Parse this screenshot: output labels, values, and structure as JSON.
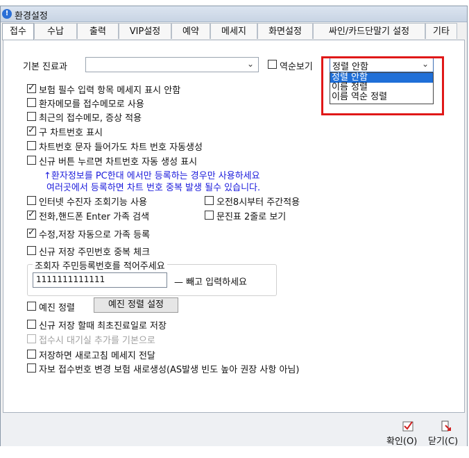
{
  "window": {
    "title": "환경설정"
  },
  "tabs": [
    "접수",
    "수납",
    "출력",
    "VIP설정",
    "예약",
    "메세지",
    "화면설정",
    "싸인/카드단말기 설정",
    "기타"
  ],
  "top_row": {
    "dept_label": "기본 진료과",
    "dept_value": "",
    "reverse_label": "역순보기",
    "sort_selected": "정렬 안함",
    "sort_options": [
      "정렬 안함",
      "이름 정렬",
      "이름 역순 정렬"
    ]
  },
  "options": [
    {
      "label": "보험 필수 입력 항목 메세지 표시 안함",
      "checked": true
    },
    {
      "label": "환자메모를 접수메모로 사용",
      "checked": false
    },
    {
      "label": "최근의 접수메모, 증상 적용",
      "checked": false
    },
    {
      "label": "구 차트번호 표시",
      "checked": true
    },
    {
      "label": "차트번호 문자 들어가도 차트 번호 자동생성",
      "checked": false
    },
    {
      "label": "신규 버튼 누르면 차트번호 자동 생성 표시",
      "checked": false
    }
  ],
  "notice": {
    "line1": "↑환자정보를 PC한대 에서만 등록하는 경우만 사용하세요",
    "line2": "여러곳에서 등록하면 차트 번호 중복 발생 될수 있습니다."
  },
  "options2": {
    "internet": {
      "label": "인터넷 수진자 조회기능 사용",
      "checked": false
    },
    "am8": {
      "label": "오전8시부터 주간적용",
      "checked": false
    },
    "phone": {
      "label": "전화,핸드폰 Enter 가족 검색",
      "checked": true
    },
    "questionnaire": {
      "label": "문진표 2줄로 보기",
      "checked": false
    },
    "autofamily": {
      "label": "수정,저장 자동으로 가족 등록",
      "checked": true
    },
    "rrn_dup": {
      "label": "신규 저장 주민번호 중복 체크",
      "checked": false
    }
  },
  "rrn_group": {
    "legend": "조회자 주민등록번호를 적어주세요",
    "value": "1111111111111",
    "hint": "— 빼고 입력하세요"
  },
  "options3": {
    "reserve_sort": {
      "label": "예진 정렬",
      "checked": false
    },
    "reserve_sort_button": "예진 정렬 설정",
    "first_visit": {
      "label": "신규 저장 할때 최초진료일로 저장",
      "checked": false
    },
    "waiting_room": {
      "label": "접수시 대기실 추가를 기본으로",
      "checked": false,
      "disabled": true
    },
    "refresh_msg": {
      "label": "저장하면 새로고침 메세지 전달",
      "checked": false
    },
    "auto_number": {
      "label": "자보 접수번호 변경 보험 새로생성(AS발생 빈도 높아 권장 사항 아님)",
      "checked": false
    }
  },
  "footer": {
    "confirm_label": "확인(O)",
    "close_label": "닫기(C)"
  },
  "colors": {
    "accent": "#1f6fd8",
    "highlight": "#e01818",
    "notice": "#1a1adb"
  }
}
